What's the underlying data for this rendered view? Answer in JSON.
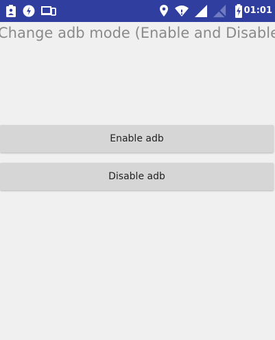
{
  "status_bar": {
    "time": "01:01",
    "left_icons": [
      "clipboard-icon",
      "data-saver-icon",
      "devices-icon"
    ],
    "right_icons": [
      "location-icon",
      "wifi-icon",
      "signal-icon",
      "no-signal-icon",
      "battery-charging-icon"
    ],
    "background_color": "#303f9f"
  },
  "main": {
    "title": "Change adb mode (Enable and Disable)",
    "enable_button_label": "Enable adb",
    "disable_button_label": "Disable adb"
  }
}
